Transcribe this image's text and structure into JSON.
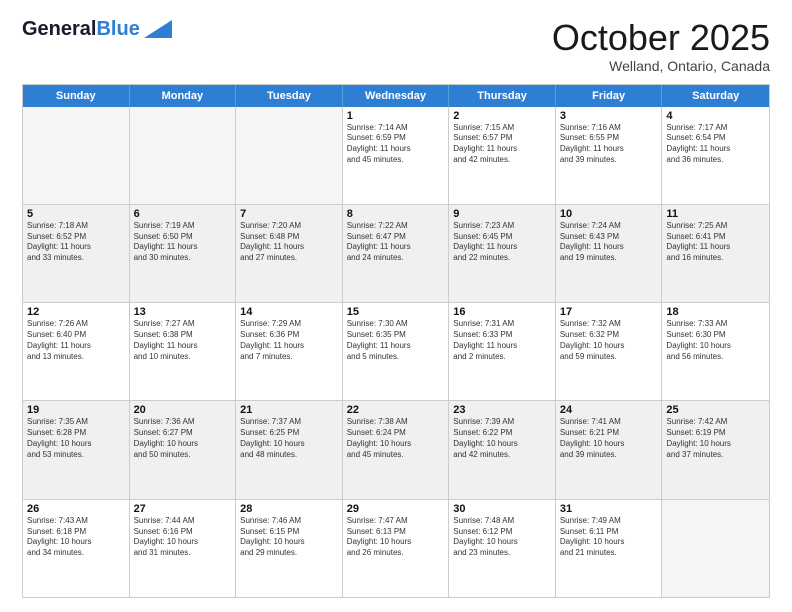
{
  "header": {
    "logo_general": "General",
    "logo_blue": "Blue",
    "month_title": "October 2025",
    "location": "Welland, Ontario, Canada"
  },
  "days_of_week": [
    "Sunday",
    "Monday",
    "Tuesday",
    "Wednesday",
    "Thursday",
    "Friday",
    "Saturday"
  ],
  "rows": [
    [
      {
        "day": "",
        "text": "",
        "empty": true
      },
      {
        "day": "",
        "text": "",
        "empty": true
      },
      {
        "day": "",
        "text": "",
        "empty": true
      },
      {
        "day": "1",
        "text": "Sunrise: 7:14 AM\nSunset: 6:59 PM\nDaylight: 11 hours\nand 45 minutes."
      },
      {
        "day": "2",
        "text": "Sunrise: 7:15 AM\nSunset: 6:57 PM\nDaylight: 11 hours\nand 42 minutes."
      },
      {
        "day": "3",
        "text": "Sunrise: 7:16 AM\nSunset: 6:55 PM\nDaylight: 11 hours\nand 39 minutes."
      },
      {
        "day": "4",
        "text": "Sunrise: 7:17 AM\nSunset: 6:54 PM\nDaylight: 11 hours\nand 36 minutes."
      }
    ],
    [
      {
        "day": "5",
        "text": "Sunrise: 7:18 AM\nSunset: 6:52 PM\nDaylight: 11 hours\nand 33 minutes.",
        "shaded": true
      },
      {
        "day": "6",
        "text": "Sunrise: 7:19 AM\nSunset: 6:50 PM\nDaylight: 11 hours\nand 30 minutes.",
        "shaded": true
      },
      {
        "day": "7",
        "text": "Sunrise: 7:20 AM\nSunset: 6:48 PM\nDaylight: 11 hours\nand 27 minutes.",
        "shaded": true
      },
      {
        "day": "8",
        "text": "Sunrise: 7:22 AM\nSunset: 6:47 PM\nDaylight: 11 hours\nand 24 minutes.",
        "shaded": true
      },
      {
        "day": "9",
        "text": "Sunrise: 7:23 AM\nSunset: 6:45 PM\nDaylight: 11 hours\nand 22 minutes.",
        "shaded": true
      },
      {
        "day": "10",
        "text": "Sunrise: 7:24 AM\nSunset: 6:43 PM\nDaylight: 11 hours\nand 19 minutes.",
        "shaded": true
      },
      {
        "day": "11",
        "text": "Sunrise: 7:25 AM\nSunset: 6:41 PM\nDaylight: 11 hours\nand 16 minutes.",
        "shaded": true
      }
    ],
    [
      {
        "day": "12",
        "text": "Sunrise: 7:26 AM\nSunset: 6:40 PM\nDaylight: 11 hours\nand 13 minutes."
      },
      {
        "day": "13",
        "text": "Sunrise: 7:27 AM\nSunset: 6:38 PM\nDaylight: 11 hours\nand 10 minutes."
      },
      {
        "day": "14",
        "text": "Sunrise: 7:29 AM\nSunset: 6:36 PM\nDaylight: 11 hours\nand 7 minutes."
      },
      {
        "day": "15",
        "text": "Sunrise: 7:30 AM\nSunset: 6:35 PM\nDaylight: 11 hours\nand 5 minutes."
      },
      {
        "day": "16",
        "text": "Sunrise: 7:31 AM\nSunset: 6:33 PM\nDaylight: 11 hours\nand 2 minutes."
      },
      {
        "day": "17",
        "text": "Sunrise: 7:32 AM\nSunset: 6:32 PM\nDaylight: 10 hours\nand 59 minutes."
      },
      {
        "day": "18",
        "text": "Sunrise: 7:33 AM\nSunset: 6:30 PM\nDaylight: 10 hours\nand 56 minutes."
      }
    ],
    [
      {
        "day": "19",
        "text": "Sunrise: 7:35 AM\nSunset: 6:28 PM\nDaylight: 10 hours\nand 53 minutes.",
        "shaded": true
      },
      {
        "day": "20",
        "text": "Sunrise: 7:36 AM\nSunset: 6:27 PM\nDaylight: 10 hours\nand 50 minutes.",
        "shaded": true
      },
      {
        "day": "21",
        "text": "Sunrise: 7:37 AM\nSunset: 6:25 PM\nDaylight: 10 hours\nand 48 minutes.",
        "shaded": true
      },
      {
        "day": "22",
        "text": "Sunrise: 7:38 AM\nSunset: 6:24 PM\nDaylight: 10 hours\nand 45 minutes.",
        "shaded": true
      },
      {
        "day": "23",
        "text": "Sunrise: 7:39 AM\nSunset: 6:22 PM\nDaylight: 10 hours\nand 42 minutes.",
        "shaded": true
      },
      {
        "day": "24",
        "text": "Sunrise: 7:41 AM\nSunset: 6:21 PM\nDaylight: 10 hours\nand 39 minutes.",
        "shaded": true
      },
      {
        "day": "25",
        "text": "Sunrise: 7:42 AM\nSunset: 6:19 PM\nDaylight: 10 hours\nand 37 minutes.",
        "shaded": true
      }
    ],
    [
      {
        "day": "26",
        "text": "Sunrise: 7:43 AM\nSunset: 6:18 PM\nDaylight: 10 hours\nand 34 minutes."
      },
      {
        "day": "27",
        "text": "Sunrise: 7:44 AM\nSunset: 6:16 PM\nDaylight: 10 hours\nand 31 minutes."
      },
      {
        "day": "28",
        "text": "Sunrise: 7:46 AM\nSunset: 6:15 PM\nDaylight: 10 hours\nand 29 minutes."
      },
      {
        "day": "29",
        "text": "Sunrise: 7:47 AM\nSunset: 6:13 PM\nDaylight: 10 hours\nand 26 minutes."
      },
      {
        "day": "30",
        "text": "Sunrise: 7:48 AM\nSunset: 6:12 PM\nDaylight: 10 hours\nand 23 minutes."
      },
      {
        "day": "31",
        "text": "Sunrise: 7:49 AM\nSunset: 6:11 PM\nDaylight: 10 hours\nand 21 minutes."
      },
      {
        "day": "",
        "text": "",
        "empty": true
      }
    ]
  ]
}
